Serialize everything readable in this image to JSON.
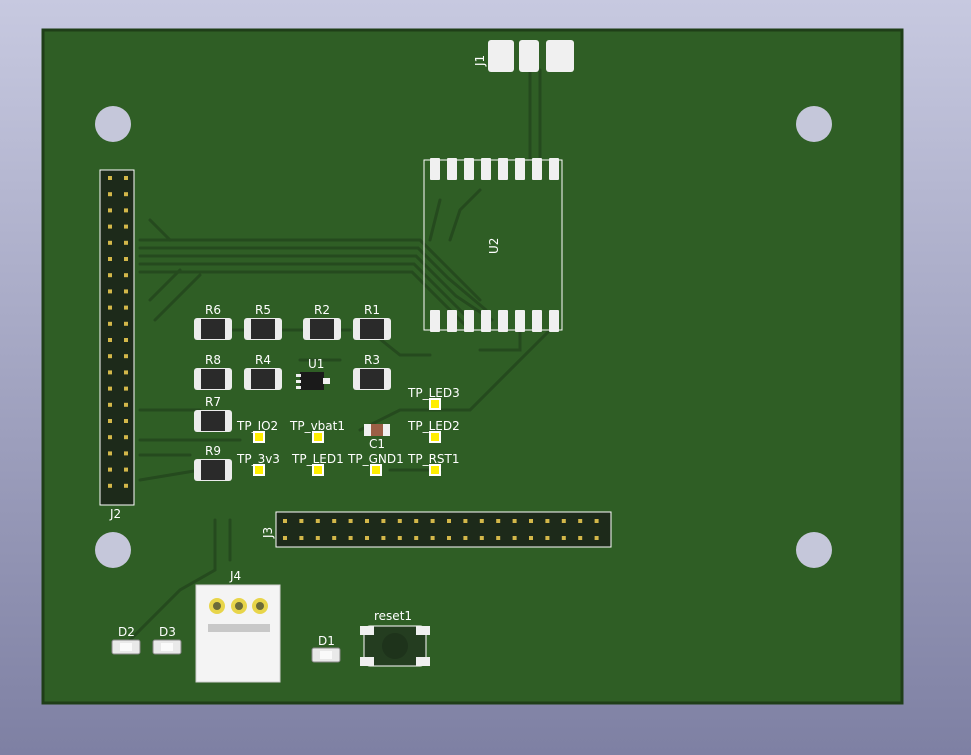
{
  "colors": {
    "background_top": "#c7c9e0",
    "background_bottom": "#7e80a3",
    "board": "#2f5e25",
    "board_edge": "#1f3e18",
    "trace": "#254a1e",
    "silkscreen": "#ffffff",
    "pad": "#f0f0f0",
    "testpoint": "#ffee00",
    "mounting_hole": "#c5c7da"
  },
  "board": {
    "designators": {
      "J1": "J1",
      "J2": "J2",
      "J3": "J3",
      "J4": "J4",
      "U1": "U1",
      "U2": "U2",
      "C1": "C1",
      "D1": "D1",
      "D2": "D2",
      "D3": "D3",
      "R1": "R1",
      "R2": "R2",
      "R3": "R3",
      "R4": "R4",
      "R5": "R5",
      "R6": "R6",
      "R7": "R7",
      "R8": "R8",
      "R9": "R9",
      "reset1": "reset1",
      "TP_LED1": "TP_LED1",
      "TP_LED2": "TP_LED2",
      "TP_LED3": "TP_LED3",
      "TP_IO2": "TP_IO2",
      "TP_vbat1": "TP_vbat1",
      "TP_3v3": "TP_3v3",
      "TP_GND1": "TP_GND1",
      "TP_RST1": "TP_RST1"
    }
  }
}
